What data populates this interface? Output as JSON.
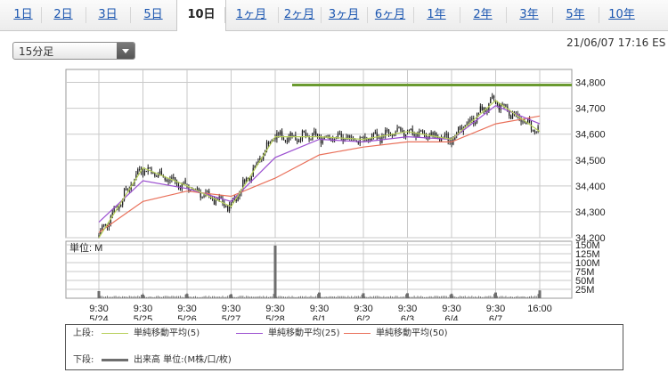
{
  "tabs": [
    {
      "label": "1日"
    },
    {
      "label": "2日"
    },
    {
      "label": "3日"
    },
    {
      "label": "5日"
    },
    {
      "label": "10日",
      "active": true
    },
    {
      "label": "1ヶ月"
    },
    {
      "label": "2ヶ月"
    },
    {
      "label": "3ヶ月"
    },
    {
      "label": "6ヶ月"
    },
    {
      "label": "1年"
    },
    {
      "label": "2年"
    },
    {
      "label": "3年"
    },
    {
      "label": "5年"
    },
    {
      "label": "10年"
    }
  ],
  "interval_select": {
    "value": "15分足"
  },
  "timestamp": "21/06/07 17:16 ES",
  "colors": {
    "ma5": "#b7cf5a",
    "ma25": "#9b4fd0",
    "ma50": "#e9705a",
    "candle": "#1a1a1a",
    "hline": "#6a9a2f",
    "volume": "#6e6e6e",
    "grid": "#c9c9c9"
  },
  "chart_data": [
    {
      "type": "line",
      "y_ticks": [
        "34,800",
        "34,700",
        "34,600",
        "34,500",
        "34,400",
        "34,300",
        "34,200"
      ],
      "ylim": [
        34200,
        34850
      ],
      "x_ticks": [
        {
          "time": "9:30",
          "date": "5/24"
        },
        {
          "time": "9:30",
          "date": "5/25"
        },
        {
          "time": "9:30",
          "date": "5/26"
        },
        {
          "time": "9:30",
          "date": "5/27"
        },
        {
          "time": "9:30",
          "date": "5/28"
        },
        {
          "time": "9:30",
          "date": "6/1"
        },
        {
          "time": "9:30",
          "date": "6/2"
        },
        {
          "time": "9:30",
          "date": "6/3"
        },
        {
          "time": "9:30",
          "date": "6/4"
        },
        {
          "time": "9:30",
          "date": "6/7"
        },
        {
          "time": "16:00",
          "date": ""
        }
      ],
      "day_closes": [
        34200,
        34470,
        34400,
        34320,
        34590,
        34590,
        34580,
        34610,
        34580,
        34730,
        34610
      ],
      "series": [
        {
          "name": "単純移動平均(5)",
          "values": [
            34200,
            34470,
            34400,
            34320,
            34590,
            34590,
            34580,
            34610,
            34580,
            34730,
            34610
          ]
        },
        {
          "name": "単純移動平均(25)",
          "values": [
            34260,
            34420,
            34390,
            34340,
            34510,
            34580,
            34570,
            34590,
            34580,
            34710,
            34640
          ]
        },
        {
          "name": "単純移動平均(50)",
          "values": [
            34220,
            34340,
            34380,
            34360,
            34430,
            34520,
            34550,
            34570,
            34570,
            34640,
            34670
          ]
        }
      ],
      "reference_line": 34790
    },
    {
      "type": "bar",
      "label": "単位: M",
      "y_ticks": [
        "150M",
        "125M",
        "100M",
        "75M",
        "50M",
        "25M"
      ],
      "ylim": [
        0,
        160
      ],
      "volume_spikes": [
        {
          "day": 0,
          "value": 20
        },
        {
          "day": 1,
          "value": 10
        },
        {
          "day": 2,
          "value": 12
        },
        {
          "day": 3,
          "value": 11
        },
        {
          "day": 4,
          "value": 148
        },
        {
          "day": 5,
          "value": 16
        },
        {
          "day": 6,
          "value": 14
        },
        {
          "day": 7,
          "value": 14
        },
        {
          "day": 8,
          "value": 12
        },
        {
          "day": 9,
          "value": 16
        },
        {
          "day": 10,
          "value": 22
        }
      ]
    }
  ],
  "legend": {
    "upper_label": "上段:",
    "lower_label": "下段:",
    "ma5": "単純移動平均(5)",
    "ma25": "単純移動平均(25)",
    "ma50": "単純移動平均(50)",
    "volume": "出来高 単位:(M株/口/枚)"
  }
}
